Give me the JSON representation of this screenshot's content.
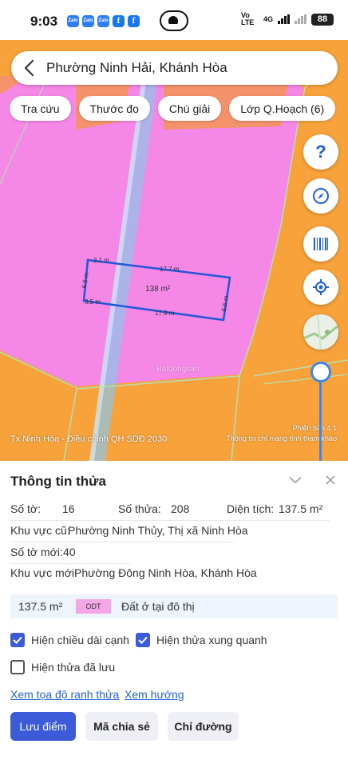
{
  "status_bar": {
    "time": "9:03",
    "apps": [
      {
        "icon": "zalo-icon",
        "text": "Zalo"
      },
      {
        "icon": "zalo-icon",
        "text": "Zalo"
      },
      {
        "icon": "zalo-icon",
        "text": "Zalo"
      },
      {
        "icon": "facebook-icon",
        "text": "f"
      },
      {
        "icon": "facebook-icon",
        "text": "f"
      }
    ],
    "network_label": "Vo LTE",
    "network_type": "4G",
    "battery": "88"
  },
  "search": {
    "title": "Phường Ninh Hải, Khánh Hòa"
  },
  "chips": [
    "Tra cứu",
    "Thước đo",
    "Chú giải",
    "Lớp Q.Hoạch (6)"
  ],
  "map": {
    "plan_label": "Tx.Ninh Hòa - Điều chỉnh QH SDĐ 2030",
    "version": "Phiên bản 4.1",
    "disclaimer": "Thông tin chỉ mang tính tham khảo",
    "parcel": {
      "top_left": "3.1 m",
      "top": "17.7 m",
      "left": "6.6 m",
      "right": "6.6 m",
      "bottom_left": "3.5 m",
      "bottom": "17.9 m",
      "area": "138 m²"
    },
    "watermark": "Batdongsan"
  },
  "panel": {
    "title": "Thông tin thửa",
    "so_to_label": "Số tờ:",
    "so_to_value": "16",
    "so_thua_label": "Số thửa:",
    "so_thua_value": "208",
    "dien_tich_label": "Diện tích:",
    "dien_tich_value": "137.5 m²",
    "kv_cu_label": "Khu vực cũ:",
    "kv_cu_value": "Phường Ninh Thủy, Thị xã Ninh Hòa",
    "so_to_moi_label": "Số tờ mới:",
    "so_to_moi_value": "40",
    "kv_moi_label": "Khu vực mới:",
    "kv_moi_value": "Phường Đông Ninh Hòa, Khánh Hòa",
    "land": {
      "area": "137.5 m²",
      "code": "ODT",
      "description": "Đất ở tại đô thị",
      "code_color": "#f4a6e6"
    },
    "options": [
      {
        "label": "Hiện chiều dài cạnh",
        "checked": true
      },
      {
        "label": "Hiện thửa xung quanh",
        "checked": true
      },
      {
        "label": "Hiện thửa đã lưu",
        "checked": false
      }
    ],
    "links": [
      "Xem tọa độ ranh thửa",
      "Xem hướng"
    ],
    "buttons": {
      "save": "Lưu điểm",
      "share": "Mã chia sẻ",
      "directions": "Chỉ đường"
    }
  },
  "colors": {
    "primary": "#3b5bd9",
    "link": "#2463d8",
    "map_orange": "#f7a23a",
    "map_pink": "#f587e6",
    "map_salmon": "#f4936b"
  }
}
